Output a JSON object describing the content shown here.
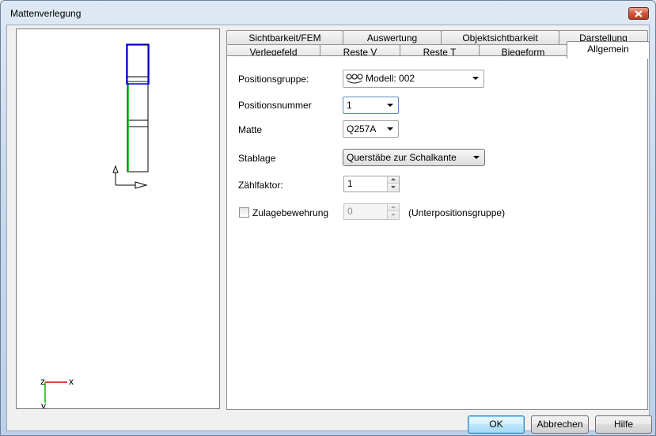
{
  "window": {
    "title": "Mattenverlegung"
  },
  "icons": {
    "close": "close-icon",
    "model": "model-group-icon",
    "dropdown": "chevron-down-icon"
  },
  "tabs_row_back": [
    {
      "label": "Sichtbarkeit/FEM"
    },
    {
      "label": "Auswertung"
    },
    {
      "label": "Objektsichtbarkeit"
    },
    {
      "label": "Darstellung"
    }
  ],
  "tabs_row_front": [
    {
      "label": "Verlegefeld"
    },
    {
      "label": "Reste V"
    },
    {
      "label": "Reste T"
    },
    {
      "label": "Biegeform"
    },
    {
      "label": "Allgemein",
      "active": true
    }
  ],
  "form": {
    "positionsgruppe_label": "Positionsgruppe:",
    "positionsgruppe_value": "Modell: 002",
    "positionsnummer_label": "Positionsnummer",
    "positionsnummer_value": "1",
    "matte_label": "Matte",
    "matte_value": "Q257A",
    "stablage_label": "Stablage",
    "stablage_value": "Querstäbe zur Schalkante",
    "zaehlfaktor_label": "Zählfaktor:",
    "zaehlfaktor_value": "1",
    "zulage_label": "Zulagebewehrung",
    "zulage_checked": false,
    "zulage_value": "0",
    "unterposition_label": "(Unterpositionsgruppe)"
  },
  "preview": {
    "axis_z": "z",
    "axis_x": "x",
    "axis_y": "y"
  },
  "buttons": {
    "ok": "OK",
    "cancel": "Abbrechen",
    "help": "Hilfe"
  },
  "colors": {
    "axis_red": "#e00000",
    "axis_green": "#00c000",
    "highlight_blue": "#0000e0"
  }
}
